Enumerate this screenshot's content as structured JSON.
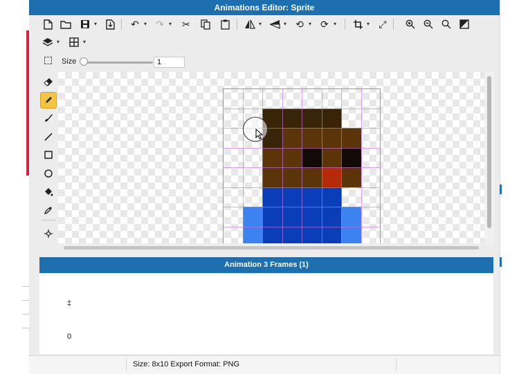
{
  "window": {
    "title": "Animations Editor: Sprite"
  },
  "toolbar": {
    "row1": [
      "new-file-icon",
      "open-folder-icon",
      "save-icon",
      "export-icon",
      "undo-icon",
      "redo-icon",
      "cut-icon",
      "copy-icon",
      "paste-icon",
      "flip-horizontal-icon",
      "flip-vertical-icon",
      "rotate-left-icon",
      "rotate-right-icon",
      "crop-icon",
      "resize-icon",
      "zoom-in-icon",
      "zoom-out-icon",
      "zoom-fit-icon",
      "color-invert-icon"
    ],
    "row2": [
      "layers-icon",
      "grid-icon"
    ]
  },
  "size_control": {
    "label": "Size",
    "value": "1",
    "slider_fraction": 0.0
  },
  "tools": [
    {
      "name": "eraser-icon",
      "active": false
    },
    {
      "name": "pencil-icon",
      "active": true
    },
    {
      "name": "brush-icon",
      "active": false
    },
    {
      "name": "line-icon",
      "active": false
    },
    {
      "name": "rectangle-icon",
      "active": false
    },
    {
      "name": "ellipse-icon",
      "active": false
    },
    {
      "name": "paint-bucket-icon",
      "active": false
    },
    {
      "name": "eyedropper-icon",
      "active": false
    },
    {
      "name": "move-icon",
      "active": false
    }
  ],
  "sprite": {
    "cols": 8,
    "visible_rows": 8,
    "palette": {
      "t": null,
      "d": "#3a2408",
      "b": "#5c3409",
      "k": "#120b05",
      "r": "#b52a0a",
      "u": "#0a3db8",
      "l": "#3c82f0"
    },
    "rows": [
      "tttttttt",
      "ttddddtt",
      "ttdbbbbt",
      "ttbbkbkt",
      "ttbbbrbt",
      "ttuuuutt",
      "tluuuult",
      "tluuuult"
    ]
  },
  "animation_panel": {
    "title": "Animation 3 Frames (1)",
    "frame_mark": "‡",
    "frame_index": "0"
  },
  "status": {
    "text": "Size: 8x10   Export Format: PNG"
  }
}
